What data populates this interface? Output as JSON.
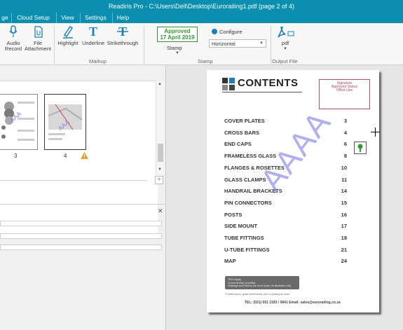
{
  "window": {
    "title": "Readiris Pro - C:\\Users\\Dell\\Desktop\\Eurorailing1.pdf (page 2 of 4)"
  },
  "menu": [
    "ge",
    "Cloud Setup",
    "View",
    "Settings",
    "Help"
  ],
  "ribbon": {
    "audio_record": "Audio\nRecord",
    "file_attachment": "File\nAttachment",
    "highlight": "Highlight",
    "underline": "Underline",
    "strikethrough": "Strikethrough",
    "markup_group": "Markup",
    "stamp_approved_line1": "Approved",
    "stamp_approved_line2": "17 April 2019",
    "stamp_label": "Stamp",
    "configure_label": "Configure",
    "orientation_value": "Horizontal",
    "stamp_group": "Stamp",
    "pdf_label": "pdf",
    "output_group": "Output File"
  },
  "thumbnails": [
    {
      "number": "3"
    },
    {
      "number": "4"
    }
  ],
  "icons": {
    "audio": "microphone-icon",
    "attachment": "paperclip-icon",
    "highlight": "highlight-pen-icon",
    "underline": "underline-T-icon",
    "strikethrough": "strikethrough-T-icon",
    "configure": "gear-icon",
    "pdf": "pdf-icon",
    "folder": "folder-icon",
    "warning": "warning-icon",
    "close": "close-icon",
    "plus": "plus-icon"
  },
  "document": {
    "heading": "CONTENTS",
    "toc": [
      {
        "title": "COVER PLATES",
        "page": "3"
      },
      {
        "title": "CROSS BARS",
        "page": "4"
      },
      {
        "title": "END CAPS",
        "page": "6"
      },
      {
        "title": "FRAMELESS GLASS",
        "page": "8"
      },
      {
        "title": "FLANGES & ROSETTES",
        "page": "10"
      },
      {
        "title": "GLASS CLAMPS",
        "page": "11"
      },
      {
        "title": "HANDRAIL BRACKETS",
        "page": "14"
      },
      {
        "title": "PIN CONNECTORS",
        "page": "15"
      },
      {
        "title": "POSTS",
        "page": "16"
      },
      {
        "title": "SIDE MOUNT",
        "page": "17"
      },
      {
        "title": "TUBE FITTINGS",
        "page": "18"
      },
      {
        "title": "U-TUBE FITTINGS",
        "page": "21"
      },
      {
        "title": "MAP",
        "page": "24"
      }
    ],
    "watermark": "AAAA",
    "stamp_text": "Signature\nApproved Status\nOffice Use",
    "footer_note": "TBC's Apply\nCorrect at time of printing\nDrawings and Pictures are not to scale, for illustration only",
    "footer_small": "*Confirm stock, grade and finishes, prior to placing an order.",
    "footer_tel": "TEL: (021) 551 2183 / 5841  Email: sales@eurorailing.co.za"
  },
  "colors": {
    "titlebar": "#0a8fb0",
    "approved_green": "#2e9b2e",
    "watermark": "#6e6ee6",
    "stamp_pink": "#e04060"
  }
}
